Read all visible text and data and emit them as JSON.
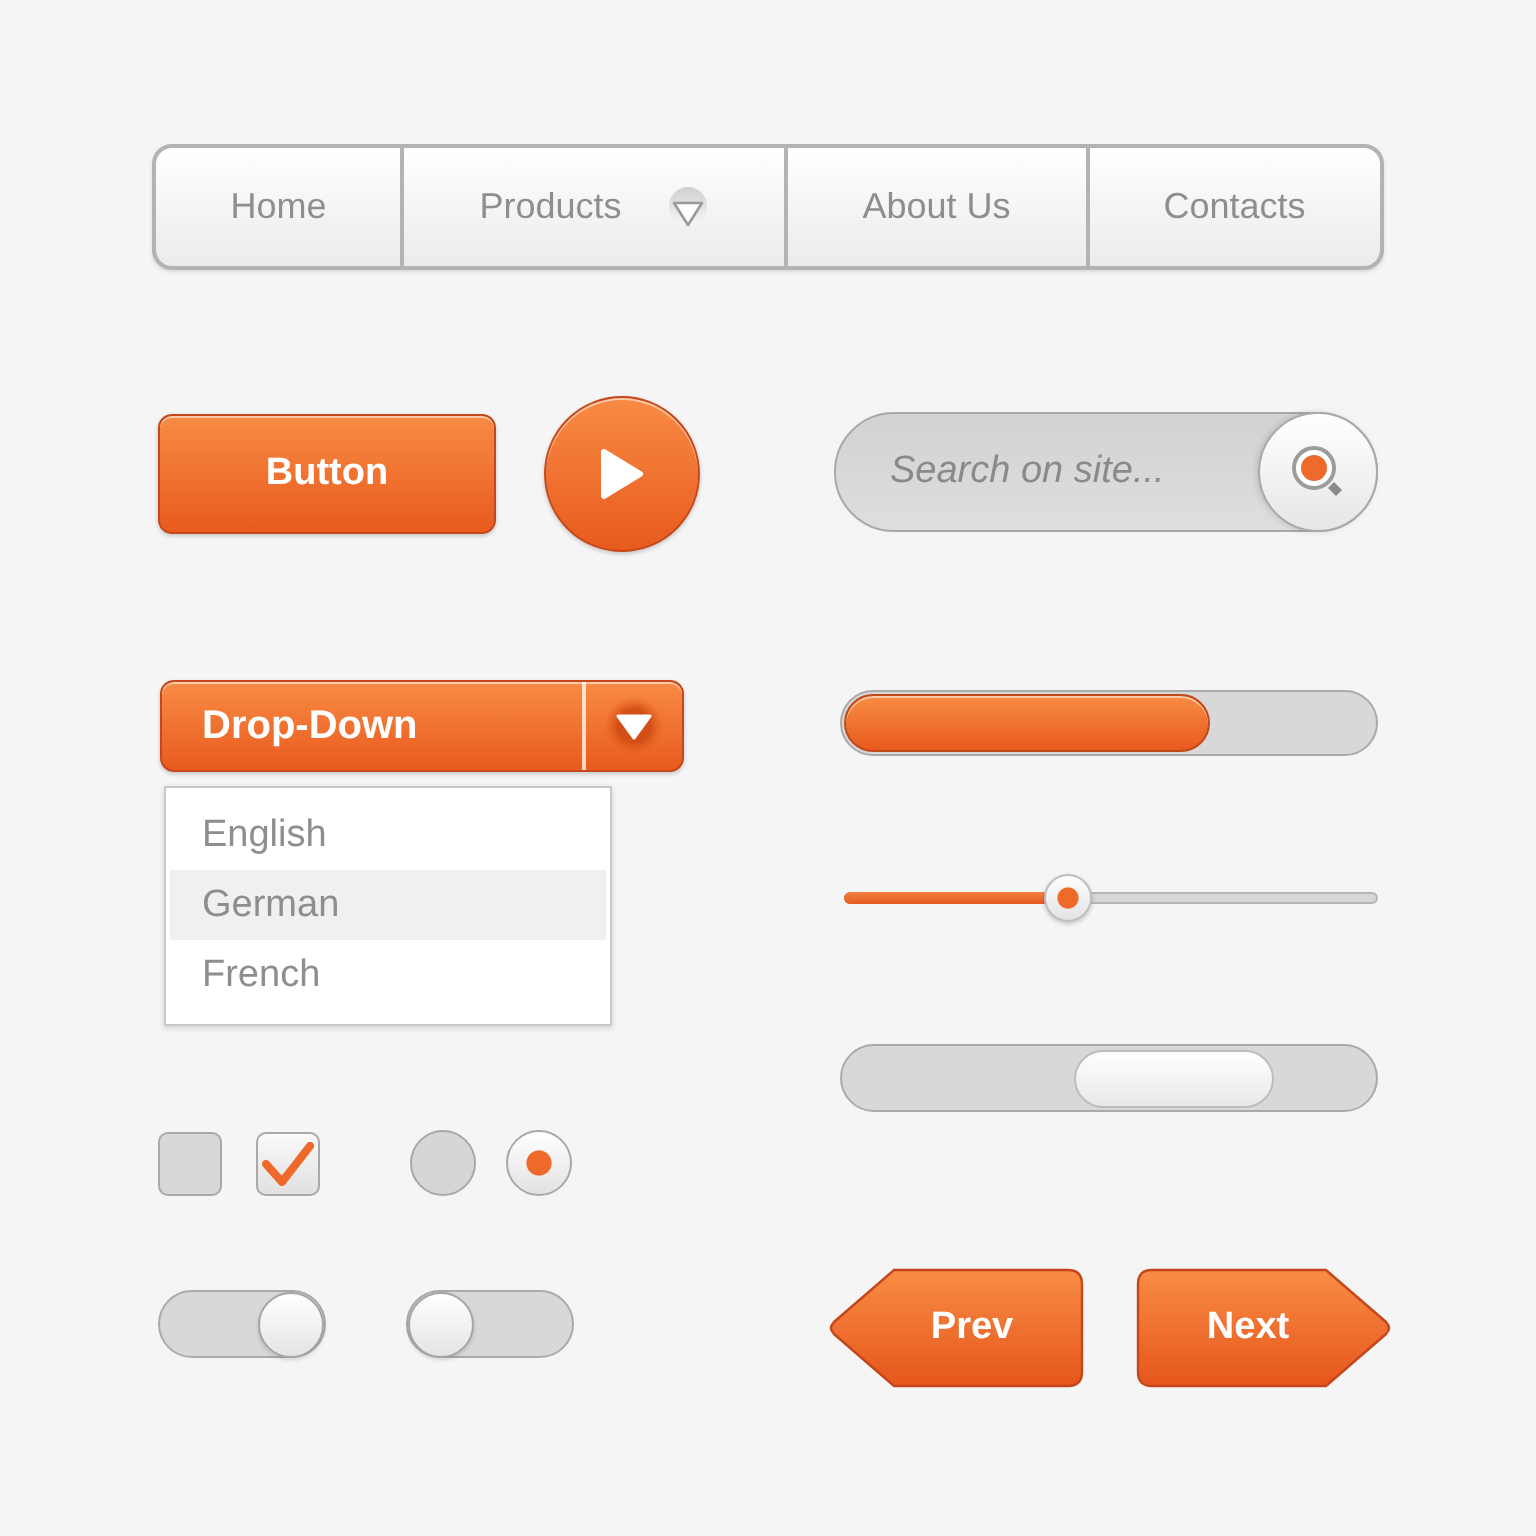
{
  "nav": {
    "items": [
      {
        "label": "Home",
        "has_menu": false
      },
      {
        "label": "Products",
        "has_menu": true
      },
      {
        "label": "About Us",
        "has_menu": false
      },
      {
        "label": "Contacts",
        "has_menu": false
      }
    ]
  },
  "button": {
    "label": "Button"
  },
  "search": {
    "placeholder": "Search on site..."
  },
  "dropdown": {
    "label": "Drop-Down",
    "expanded": true,
    "options": [
      {
        "label": "English",
        "selected": false
      },
      {
        "label": "German",
        "selected": true
      },
      {
        "label": "French",
        "selected": false
      }
    ]
  },
  "progress": {
    "level": 0.69
  },
  "slider": {
    "level": 0.42
  },
  "checkboxes": [
    {
      "checked": false
    },
    {
      "checked": true
    }
  ],
  "radios": [
    {
      "selected": false
    },
    {
      "selected": true
    }
  ],
  "toggles": [
    {
      "on": true
    },
    {
      "on": false
    }
  ],
  "pager": [
    {
      "kind": "prev",
      "label": "Prev"
    },
    {
      "kind": "next",
      "label": "Next"
    }
  ]
}
